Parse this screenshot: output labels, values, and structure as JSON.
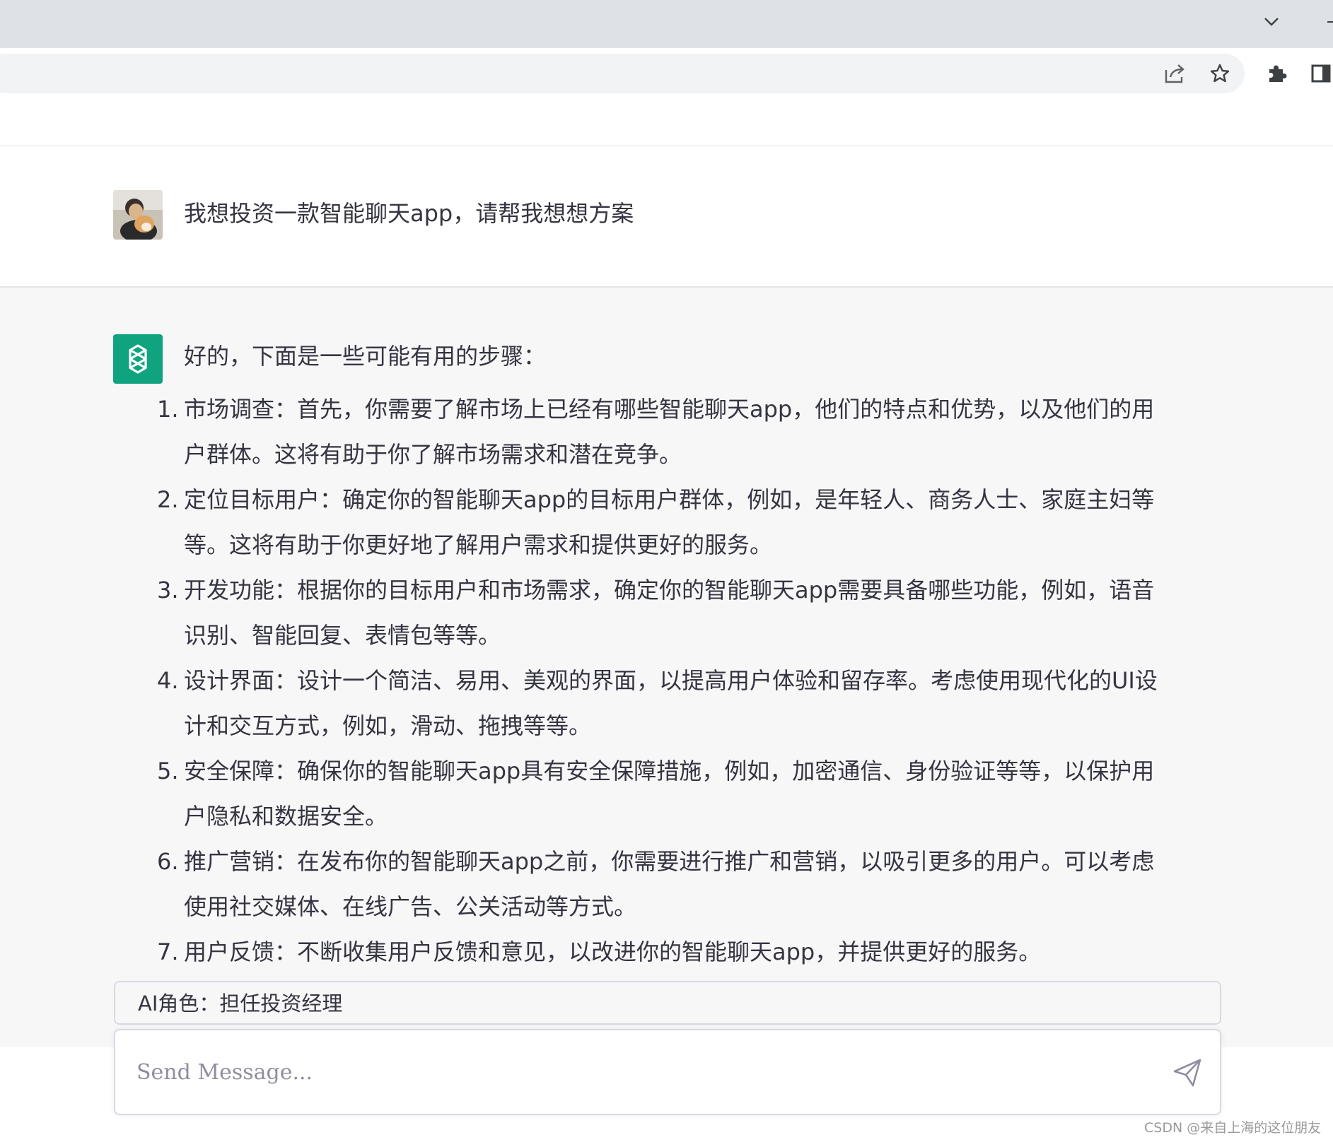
{
  "browser": {
    "icons": [
      "chevron-down-icon",
      "share-icon",
      "star-icon",
      "extension-icon",
      "side-panel-icon"
    ]
  },
  "conversation": {
    "user": {
      "message": "我想投资一款智能聊天app，请帮我想想方案"
    },
    "assistant": {
      "intro": "好的，下面是一些可能有用的步骤：",
      "steps": [
        {
          "num": "1.",
          "text": "市场调查：首先，你需要了解市场上已经有哪些智能聊天app，他们的特点和优势，以及他们的用户群体。这将有助于你了解市场需求和潜在竞争。"
        },
        {
          "num": "2.",
          "text": "定位目标用户：确定你的智能聊天app的目标用户群体，例如，是年轻人、商务人士、家庭主妇等等。这将有助于你更好地了解用户需求和提供更好的服务。"
        },
        {
          "num": "3.",
          "text": "开发功能：根据你的目标用户和市场需求，确定你的智能聊天app需要具备哪些功能，例如，语音识别、智能回复、表情包等等。"
        },
        {
          "num": "4.",
          "text": "设计界面：设计一个简洁、易用、美观的界面，以提高用户体验和留存率。考虑使用现代化的UI设计和交互方式，例如，滑动、拖拽等等。"
        },
        {
          "num": "5.",
          "text": "安全保障：确保你的智能聊天app具有安全保障措施，例如，加密通信、身份验证等等，以保护用户隐私和数据安全。"
        },
        {
          "num": "6.",
          "text": "推广营销：在发布你的智能聊天app之前，你需要进行推广和营销，以吸引更多的用户。可以考虑使用社交媒体、在线广告、公关活动等方式。"
        },
        {
          "num": "7.",
          "text": "用户反馈：不断收集用户反馈和意见，以改进你的智能聊天app，并提供更好的服务。"
        }
      ]
    }
  },
  "role_bar": {
    "label": "AI角色：担任投资经理"
  },
  "composer": {
    "placeholder": "Send Message..."
  },
  "watermark": "CSDN @来自上海的这位朋友",
  "colors": {
    "assistant_avatar_bg": "#10a37f",
    "assistant_row_bg": "#f7f7f8",
    "text": "#343541"
  }
}
